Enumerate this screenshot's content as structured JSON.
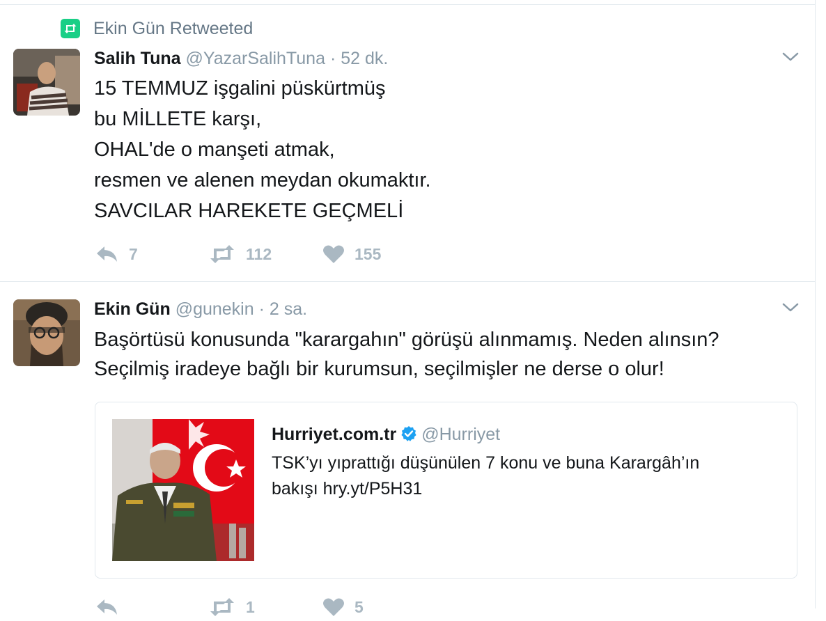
{
  "timeline": {
    "retweet_context": {
      "icon": "retweet-icon",
      "text": "Ekin Gün Retweeted"
    },
    "tweets": [
      {
        "author_name": "Salih Tuna",
        "author_handle": "@YazarSalihTuna",
        "time": "· 52 dk.",
        "text_lines": [
          "15 TEMMUZ işgalini püskürtmüş",
          "bu MİLLETE karşı,",
          "OHAL'de o manşeti atmak,",
          "resmen ve alenen meydan okumaktır.",
          "SAVCILAR HAREKETE GEÇMELİ"
        ],
        "reply_count": "7",
        "retweet_count": "112",
        "like_count": "155"
      },
      {
        "author_name": "Ekin Gün",
        "author_handle": "@gunekin",
        "time": "· 2 sa.",
        "text_lines": [
          "Başörtüsü konusunda \"karargahın\" görüşü alınmamış. Neden alınsın?",
          "Seçilmiş iradeye bağlı bir kurumsun, seçilmişler ne derse o olur!"
        ],
        "quoted": {
          "name": "Hurriyet.com.tr",
          "handle": "@Hurriyet",
          "text_lines": [
            "TSK’yı yıprattığı düşünülen 7 konu ve buna Karargâh’ın",
            "bakışı hry.yt/P5H31"
          ]
        },
        "reply_count": "",
        "retweet_count": "1",
        "like_count": "5"
      }
    ]
  },
  "colors": {
    "retweet_green": "#19cf86",
    "muted_text": "#8899a6",
    "action_gray": "#aab8c2",
    "verified_blue": "#1da1f2",
    "flag_red": "#e30a17"
  }
}
